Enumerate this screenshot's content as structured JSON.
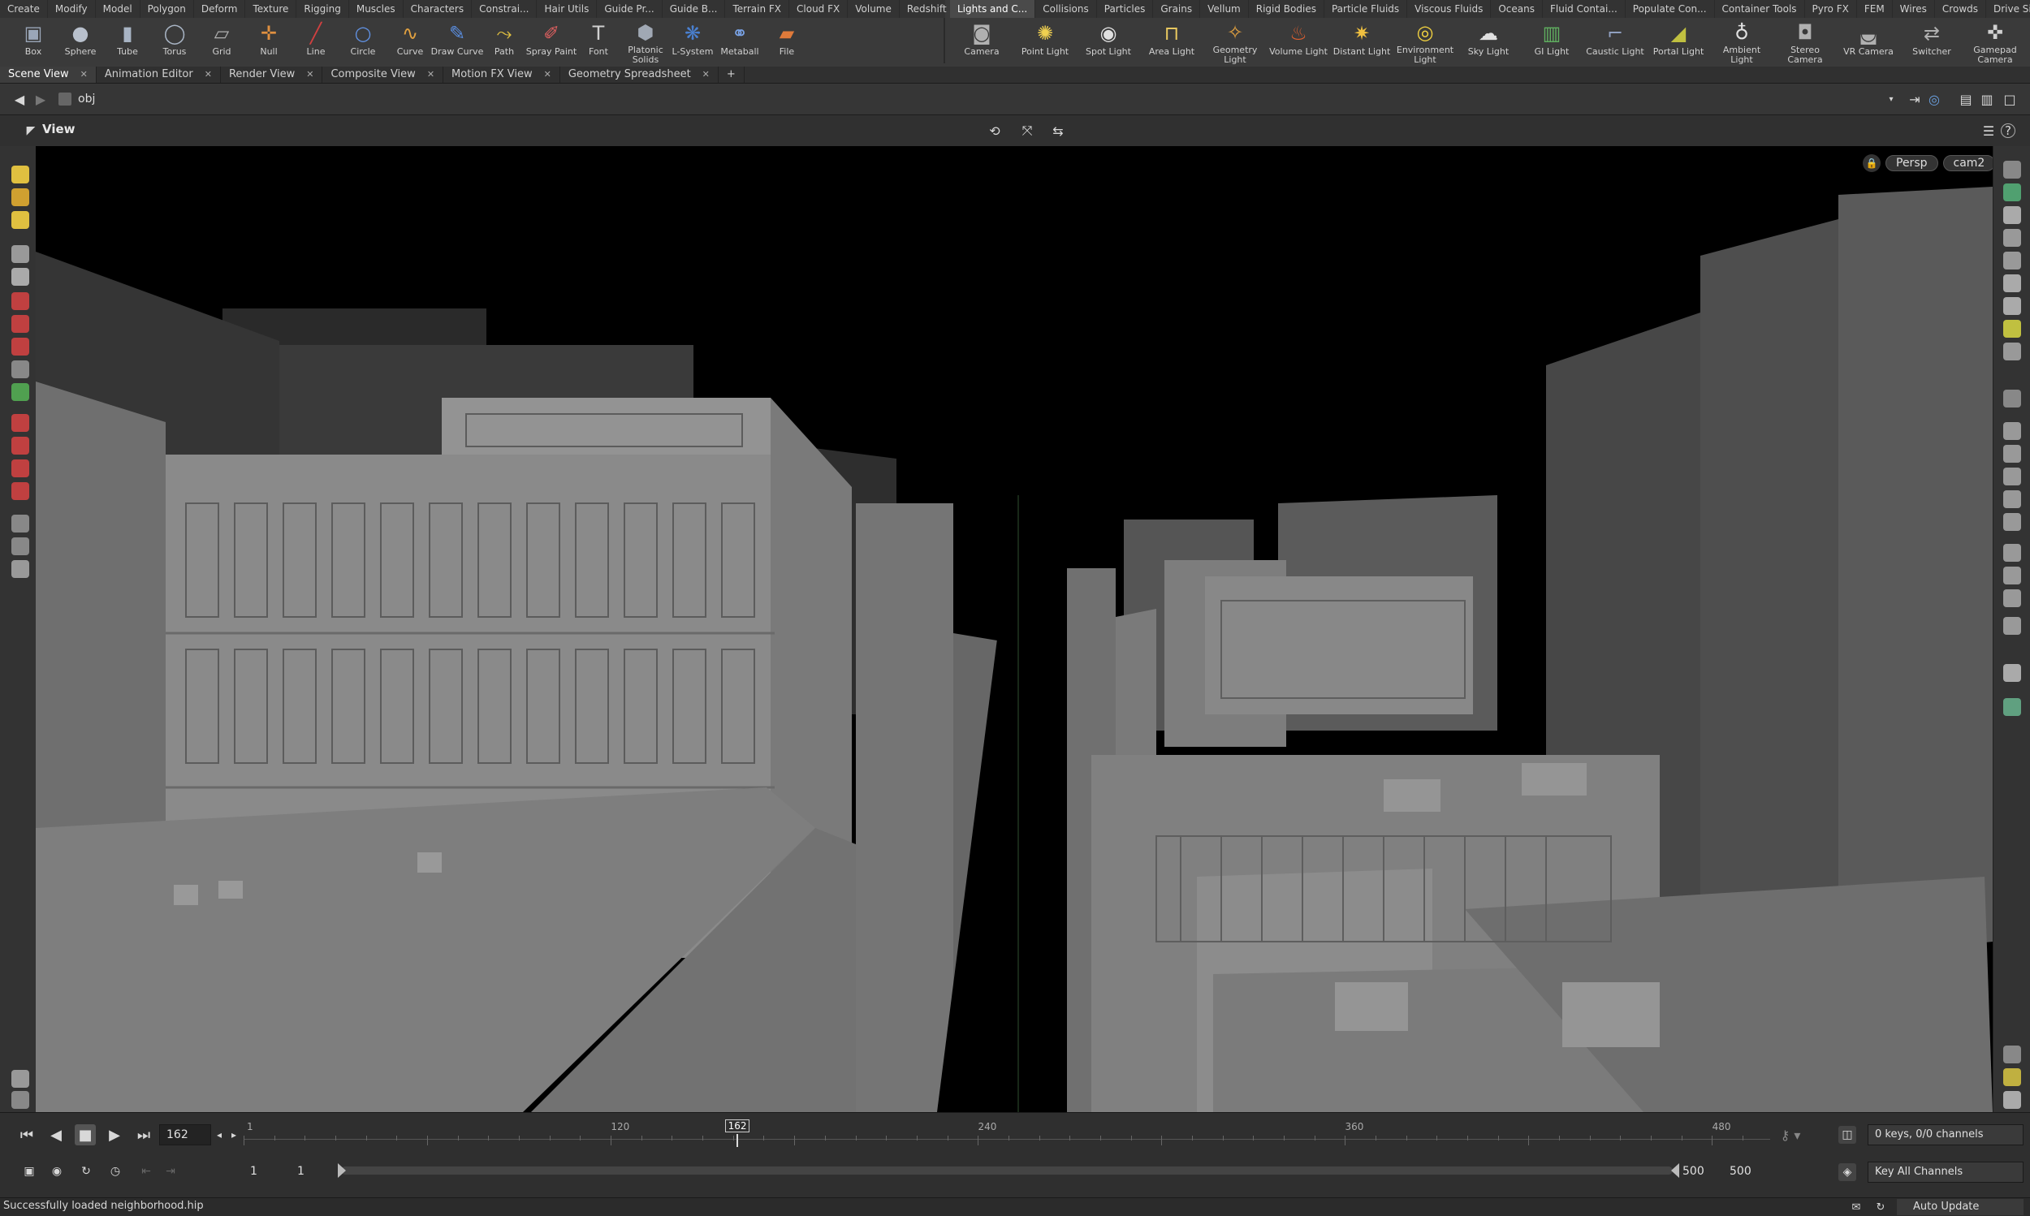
{
  "shelf": {
    "left_tabs": [
      "Create",
      "Modify",
      "Model",
      "Polygon",
      "Deform",
      "Texture",
      "Rigging",
      "Muscles",
      "Characters",
      "Constrai...",
      "Hair Utils",
      "Guide Pr...",
      "Guide B...",
      "Terrain FX",
      "Cloud FX",
      "Volume",
      "Redshift"
    ],
    "left_add": "+ ▾",
    "right_tabs": [
      "Lights and C...",
      "Collisions",
      "Particles",
      "Grains",
      "Vellum",
      "Rigid Bodies",
      "Particle Fluids",
      "Viscous Fluids",
      "Oceans",
      "Fluid Contai...",
      "Populate Con...",
      "Container Tools",
      "Pyro FX",
      "FEM",
      "Wires",
      "Crowds",
      "Drive Simula..."
    ],
    "right_more": "▾",
    "left_tools": [
      {
        "label": "Box",
        "icon": "box-icon",
        "glyph": "▣",
        "color": "#9aa6b8"
      },
      {
        "label": "Sphere",
        "icon": "sphere-icon",
        "glyph": "●",
        "color": "#b8c0cc"
      },
      {
        "label": "Tube",
        "icon": "tube-icon",
        "glyph": "▮",
        "color": "#a8b4c4"
      },
      {
        "label": "Torus",
        "icon": "torus-icon",
        "glyph": "◯",
        "color": "#a8b4c4"
      },
      {
        "label": "Grid",
        "icon": "grid-icon",
        "glyph": "▱",
        "color": "#b0b0b0"
      },
      {
        "label": "Null",
        "icon": "null-icon",
        "glyph": "✛",
        "color": "#e09040"
      },
      {
        "label": "Line",
        "icon": "line-icon",
        "glyph": "╱",
        "color": "#d04040"
      },
      {
        "label": "Circle",
        "icon": "circle-icon",
        "glyph": "○",
        "color": "#6090e0"
      },
      {
        "label": "Curve",
        "icon": "curve-icon",
        "glyph": "∿",
        "color": "#e0a040"
      },
      {
        "label": "Draw Curve",
        "icon": "draw-curve-icon",
        "glyph": "✎",
        "color": "#5a8ee0"
      },
      {
        "label": "Path",
        "icon": "path-icon",
        "glyph": "⤳",
        "color": "#e0c040"
      },
      {
        "label": "Spray Paint",
        "icon": "spray-paint-icon",
        "glyph": "✐",
        "color": "#e06060"
      },
      {
        "label": "Font",
        "icon": "font-icon",
        "glyph": "T",
        "color": "#d0d0d0"
      },
      {
        "label": "Platonic Solids",
        "icon": "platonic-solids-icon",
        "glyph": "⬢",
        "color": "#a0a8b4"
      },
      {
        "label": "L-System",
        "icon": "l-system-icon",
        "glyph": "❋",
        "color": "#4a80d0"
      },
      {
        "label": "Metaball",
        "icon": "metaball-icon",
        "glyph": "⚭",
        "color": "#7aa4e8"
      },
      {
        "label": "File",
        "icon": "file-icon",
        "glyph": "▰",
        "color": "#e07a3a"
      }
    ],
    "right_tools": [
      {
        "label": "Camera",
        "icon": "camera-icon",
        "glyph": "◙",
        "color": "#b0b0b0"
      },
      {
        "label": "Point Light",
        "icon": "point-light-icon",
        "glyph": "✺",
        "color": "#f0d050"
      },
      {
        "label": "Spot Light",
        "icon": "spot-light-icon",
        "glyph": "◉",
        "color": "#e0e0e0"
      },
      {
        "label": "Area Light",
        "icon": "area-light-icon",
        "glyph": "⊓",
        "color": "#e8c860"
      },
      {
        "label": "Geometry Light",
        "icon": "geometry-light-icon",
        "glyph": "✧",
        "color": "#e0a040"
      },
      {
        "label": "Volume Light",
        "icon": "volume-light-icon",
        "glyph": "♨",
        "color": "#e06030"
      },
      {
        "label": "Distant Light",
        "icon": "distant-light-icon",
        "glyph": "✷",
        "color": "#f0c040"
      },
      {
        "label": "Environment Light",
        "icon": "environment-light-icon",
        "glyph": "◎",
        "color": "#f0d040"
      },
      {
        "label": "Sky Light",
        "icon": "sky-light-icon",
        "glyph": "☁",
        "color": "#e0e0e0"
      },
      {
        "label": "GI Light",
        "icon": "gi-light-icon",
        "glyph": "▥",
        "color": "#60b060"
      },
      {
        "label": "Caustic Light",
        "icon": "caustic-light-icon",
        "glyph": "⌐",
        "color": "#90a0c0"
      },
      {
        "label": "Portal Light",
        "icon": "portal-light-icon",
        "glyph": "◢",
        "color": "#c0c040"
      },
      {
        "label": "Ambient Light",
        "icon": "ambient-light-icon",
        "glyph": "♁",
        "color": "#e0e0e0"
      },
      {
        "label": "Stereo Camera",
        "icon": "stereo-camera-icon",
        "glyph": "◘",
        "color": "#b0b0b0"
      },
      {
        "label": "VR Camera",
        "icon": "vr-camera-icon",
        "glyph": "◛",
        "color": "#b0b0b0"
      },
      {
        "label": "Switcher",
        "icon": "switcher-icon",
        "glyph": "⇄",
        "color": "#b0b0b0"
      },
      {
        "label": "Gamepad Camera",
        "icon": "gamepad-camera-icon",
        "glyph": "✜",
        "color": "#d0d0d0"
      }
    ]
  },
  "pane_tabs": [
    "Scene View",
    "Animation Editor",
    "Render View",
    "Composite View",
    "Motion FX View",
    "Geometry Spreadsheet"
  ],
  "pane_add": "+",
  "path": {
    "network": "obj"
  },
  "view": {
    "title": "View",
    "projection": "Persp",
    "camera": "cam2"
  },
  "timeline": {
    "current_frame": "162",
    "ticks": [
      "1",
      "120",
      "240",
      "360",
      "480"
    ],
    "marker": "162",
    "start": "1",
    "start2": "1",
    "end": "500",
    "end2": "500",
    "keys_status": "0 keys, 0/0 channels",
    "key_all": "Key All Channels"
  },
  "status": {
    "message": "Successfully loaded neighborhood.hip",
    "update_mode": "Auto Update"
  }
}
